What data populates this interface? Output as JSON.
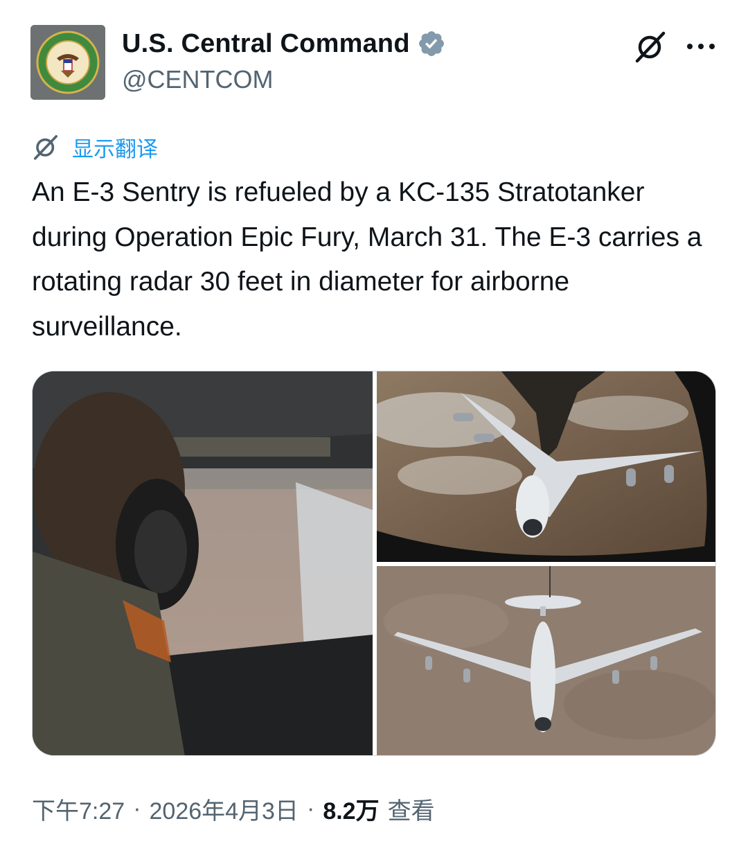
{
  "author": {
    "display_name": "U.S. Central Command",
    "handle": "@CENTCOM",
    "avatar_icon": "centcom-seal-icon",
    "verified": true
  },
  "header_actions": {
    "grok_icon": "grok-icon",
    "more_icon": "more-horizontal-icon"
  },
  "translate": {
    "icon": "grok-icon",
    "label": "显示翻译"
  },
  "tweet": {
    "text": "An E-3 Sentry is refueled by a KC-135 Stratotanker during Operation Epic Fury, March 31. The E-3 carries a rotating radar 30 feet in diameter for airborne surveillance."
  },
  "media": [
    {
      "kind": "photo"
    },
    {
      "kind": "photo"
    },
    {
      "kind": "photo"
    }
  ],
  "meta": {
    "time": "下午7:27",
    "separator": "·",
    "date": "2026年4月3日",
    "views_count": "8.2万",
    "views_label": "查看"
  },
  "colors": {
    "accent": "#1d9bf0",
    "text": "#0f1419",
    "secondary": "#536471",
    "verified_badge": "#829aab"
  }
}
